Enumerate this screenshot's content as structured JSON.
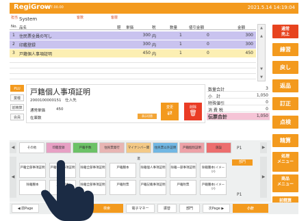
{
  "header": {
    "app": "RegiGrow",
    "version": "Ver 7.00.00",
    "datetime": "2021.5.14 14:19:04"
  },
  "register": {
    "info_labels": {
      "store": "担当",
      "member": "客数",
      "customer": "客層"
    },
    "store_name": "System",
    "columns": {
      "no": "No.",
      "name": "品名",
      "type": "軽",
      "unit_price": "単価",
      "tax": "税",
      "qty": "数量",
      "discount": "値引金額",
      "amount": "金額"
    },
    "rows": [
      {
        "no": "1",
        "name": "住民票全員の写し",
        "unit_price": "300",
        "tax": "内",
        "qty": "1",
        "discount": "0",
        "amount": "300",
        "style": "purple"
      },
      {
        "no": "2",
        "name": "印鑑登録",
        "unit_price": "300",
        "tax": "内",
        "qty": "1",
        "discount": "0",
        "amount": "300",
        "style": "purple"
      },
      {
        "no": "3",
        "name": "戸籍個人事項証明",
        "unit_price": "450",
        "tax": "内",
        "qty": "1",
        "discount": "0",
        "amount": "450",
        "style": "yellow"
      }
    ]
  },
  "function_buttons": [
    {
      "label": "通常\n売上",
      "color": "#e7431e"
    },
    {
      "label": "練習",
      "color": "#f39a1e"
    },
    {
      "label": "戻し",
      "color": "#f39a1e"
    },
    {
      "label": "返品",
      "color": "#f39a1e"
    },
    {
      "label": "訂正",
      "color": "#f39a1e"
    },
    {
      "label": "点検",
      "color": "#f39a1e"
    },
    {
      "label": "精算",
      "color": "#f39a1e"
    },
    {
      "label": "処理\nメニュー",
      "color": "#f39a1e"
    },
    {
      "label": "商品\nメニュー",
      "color": "#f39a1e"
    },
    {
      "label": "前精算\n精算",
      "color": "#f39a1e"
    }
  ],
  "product": {
    "side_tags": [
      "PLU",
      "業種",
      "前精算",
      "会員"
    ],
    "title": "戸籍個人事項証明",
    "code": "2000100000151",
    "supplier": "仕入先",
    "price_label": "通常単価",
    "price": "450",
    "stock_label": "在庫数",
    "btn_update": "表示切替",
    "btn_change": "変更",
    "btn_delete": "削除"
  },
  "totals": {
    "rows": [
      {
        "label": "数量合計",
        "value": "3"
      },
      {
        "label": "小　計",
        "value": "1,050"
      },
      {
        "label": "特殊値引",
        "value": "0"
      },
      {
        "label": "消 費 税",
        "value": "0"
      },
      {
        "label": "伝票合計",
        "value": "1,050"
      }
    ]
  },
  "keys": {
    "tabs": [
      {
        "label": "その他",
        "color": "#ffffff"
      },
      {
        "label": "印鑑登録",
        "color": "#e7a0c4"
      },
      {
        "label": "戸籍手数",
        "color": "#6cc267"
      },
      {
        "label": "住民票発行",
        "color": "#e8b5b3"
      },
      {
        "label": "マイナンバー関連",
        "color": "#f3c986"
      },
      {
        "label": "住民票以外証明",
        "color": "#71b7e3"
      },
      {
        "label": "戸籍個別証明",
        "color": "#eda1a7"
      },
      {
        "label": "施設",
        "color": "#ec6e6e"
      }
    ],
    "row1": [
      "戸籍全部事項証明",
      "戸籍個人事項証明",
      "除籍全部事項証明",
      "戸籍謄本",
      "除籍個人事項証明",
      "除籍一部事項証明",
      "除籍謄本(イメージ)"
    ],
    "row2": [
      "除籍謄本",
      "戸籍謄本",
      "除籍全部事項証明",
      "戸籍附票",
      "戸籍記載事項証明",
      "戸籍附票",
      "戸籍謄本(イメージ)"
    ],
    "page_indicator": "P1",
    "category_label": "部門"
  },
  "bottom": {
    "prev": "◀ 前Page",
    "buttons": [
      "検索",
      "電子マネー",
      "振替",
      "部門"
    ],
    "next": "次Page ▶",
    "subtotal": "小計"
  }
}
